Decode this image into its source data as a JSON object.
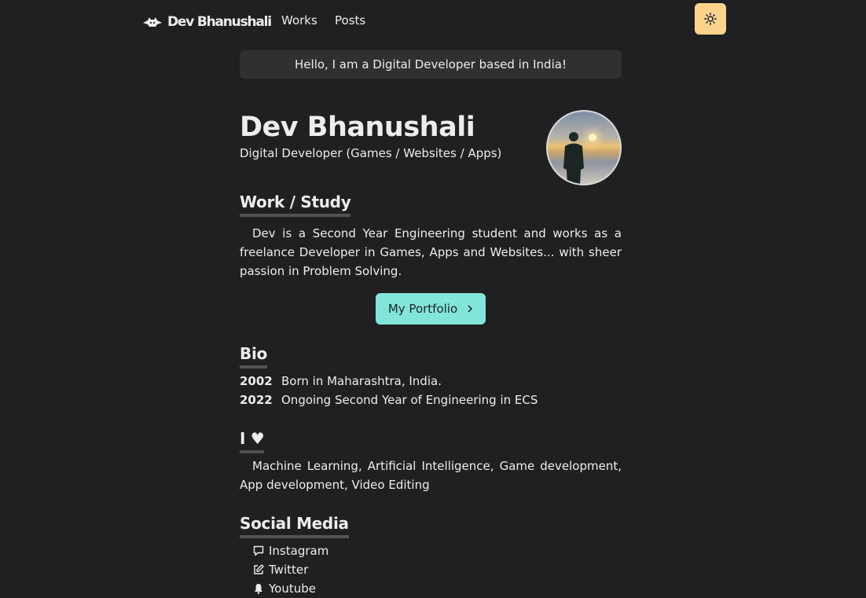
{
  "navbar": {
    "brand": "Dev Bhanushali",
    "links": [
      "Works",
      "Posts"
    ],
    "theme_icon": "sun-icon",
    "theme_color": "#fbd38d"
  },
  "greeting": "Hello, I am a Digital Developer based in India!",
  "hero": {
    "name": "Dev Bhanushali",
    "role": "Digital Developer (Games / Websites / Apps)"
  },
  "work": {
    "title": "Work / Study",
    "text": "Dev is a Second Year Engineering student and works as a freelance Developer in Games, Apps and Websites... with sheer passion in Problem Solving.",
    "button_label": "My Portfolio",
    "button_color": "#81e6d9"
  },
  "bio": {
    "title": "Bio",
    "entries": [
      {
        "year": "2002",
        "text": "Born in Maharashtra, India."
      },
      {
        "year": "2022",
        "text": "Ongoing Second Year of Engineering in ECS"
      }
    ]
  },
  "loves": {
    "title": "I ♥",
    "text": "Machine Learning, Artificial Intelligence, Game development, App development, Video Editing"
  },
  "social": {
    "title": "Social Media",
    "items": [
      {
        "label": "Instagram",
        "icon": "chat-bubble-icon"
      },
      {
        "label": "Twitter",
        "icon": "edit-icon"
      },
      {
        "label": "Youtube",
        "icon": "bell-icon"
      }
    ]
  }
}
